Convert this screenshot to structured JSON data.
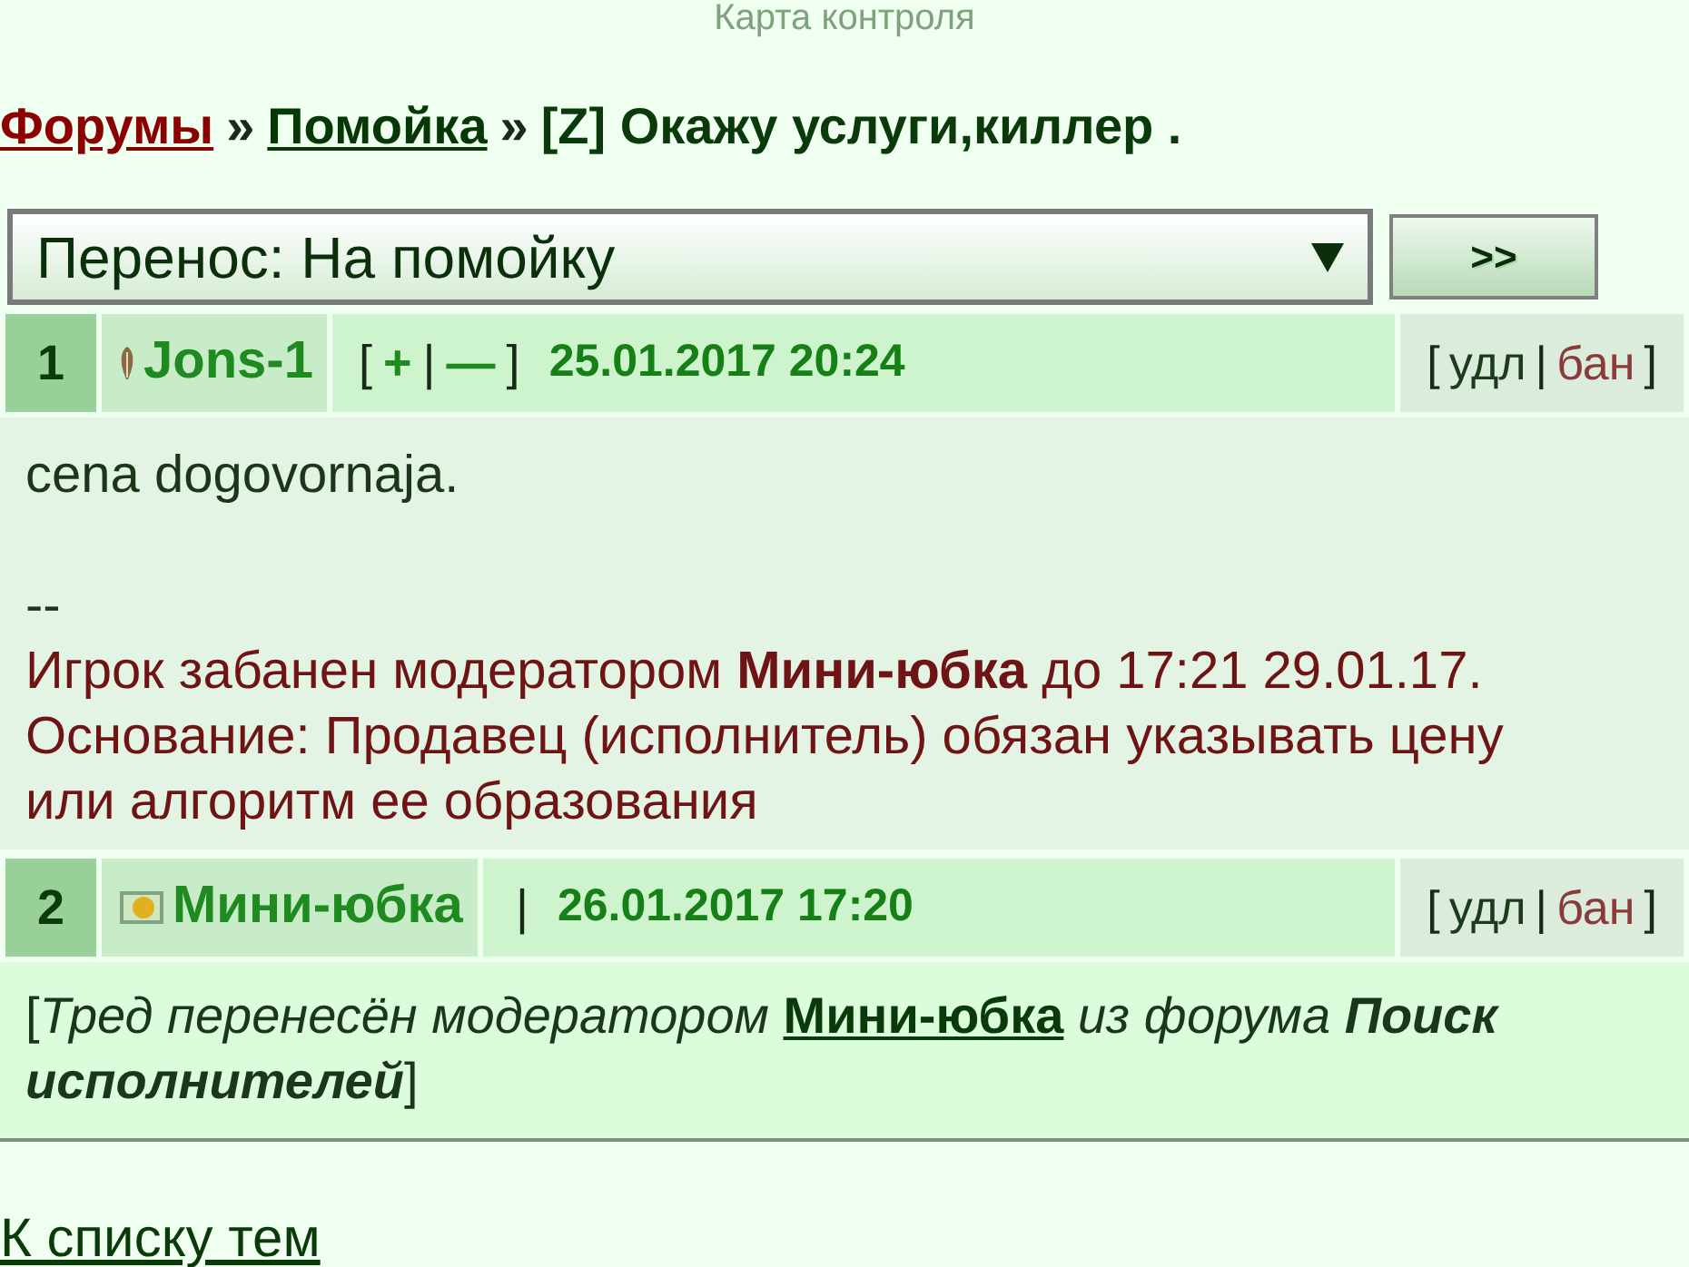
{
  "top_text": "Карта контроля",
  "breadcrumb": [
    {
      "kind": "link",
      "label": "Форумы",
      "visited": true
    },
    {
      "kind": "separator",
      "label": "»"
    },
    {
      "kind": "link",
      "label": "Помойка",
      "visited": false
    },
    {
      "kind": "separator",
      "label": "»"
    },
    {
      "kind": "current",
      "label": "[Z] Окажу услуги,киллер ."
    }
  ],
  "move_form": {
    "select_value": "Перенос: На помойку",
    "submit_button": ">>"
  },
  "posts": [
    {
      "kind": "message",
      "number": "1",
      "author": "Jons-1",
      "vote": {
        "open": "[",
        "plus": "+",
        "separator": "|",
        "minus": "—",
        "close": "]"
      },
      "date": "25.01.2017 20:24",
      "actions": {
        "open": "[",
        "delete": "удл",
        "separator": "|",
        "ban": "бан",
        "close": "]"
      },
      "body": {
        "text": "cena dogovornaja.",
        "signature": "--",
        "ban_notice": "Игрок забанен модератором **Мини-юбка** до 17:21 29.01.17.",
        "ban_reason": "Основание: Продавец (исполнитель) обязан указывать цену или алгоритм ее образования"
      }
    },
    {
      "kind": "notice",
      "number": "2",
      "author": "Мини-юбка",
      "divider": "|",
      "date": "26.01.2017 17:20",
      "actions": {
        "open": "[",
        "delete": "удл",
        "separator": "|",
        "ban": "бан",
        "close": "]"
      },
      "body": {
        "open": "[",
        "text_before": "Тред перенесён модератором",
        "moderator": "Мини-юбка",
        "text_after": "из форума **Поиск исполнителей**",
        "close": "]"
      }
    }
  ],
  "back_link": "К списку тем"
}
